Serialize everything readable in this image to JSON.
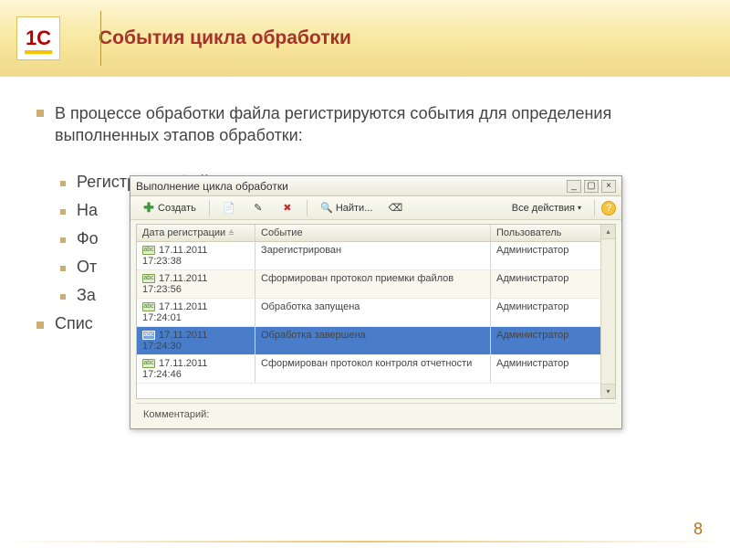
{
  "slide": {
    "title": "События цикла обработки",
    "logo_text": "1С",
    "page_number": "8",
    "intro": "В процессе обработки файла регистрируются события для определения выполненных этапов обработки:",
    "bullets": [
      "Регистрация файла",
      "На",
      "Фо",
      "От",
      "За"
    ],
    "last_bullet": "Спис"
  },
  "window": {
    "title": "Выполнение цикла обработки",
    "toolbar": {
      "create_label": "Создать",
      "find_label": "Найти...",
      "actions_label": "Все действия"
    },
    "columns": {
      "c1": "Дата регистрации",
      "c2": "Событие",
      "c3": "Пользователь"
    },
    "rows": [
      {
        "date": "17.11.2011 17:23:38",
        "event": "Зарегистрирован",
        "user": "Администратор"
      },
      {
        "date": "17.11.2011 17:23:56",
        "event": "Сформирован протокол приемки файлов",
        "user": "Администратор"
      },
      {
        "date": "17.11.2011 17:24:01",
        "event": "Обработка запущена",
        "user": "Администратор"
      },
      {
        "date": "17.11.2011 17:24:30",
        "event": "Обработка завершена",
        "user": "Администратор"
      },
      {
        "date": "17.11.2011 17:24:46",
        "event": "Сформирован протокол контроля отчетности",
        "user": "Администратор"
      }
    ],
    "footer_label": "Комментарий:"
  }
}
